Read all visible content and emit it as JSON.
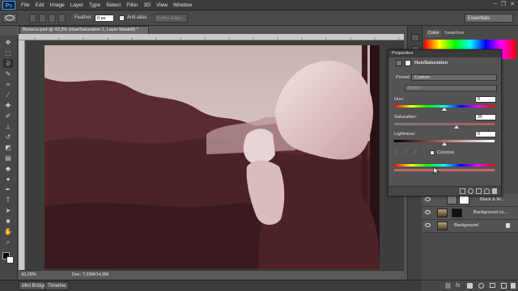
{
  "app": {
    "logo": "Ps"
  },
  "menu": [
    "File",
    "Edit",
    "Image",
    "Layer",
    "Type",
    "Select",
    "Filter",
    "3D",
    "View",
    "Window"
  ],
  "window_controls": {
    "minimize": "–",
    "restore": "❐",
    "close": "✕"
  },
  "options_bar": {
    "feather_label": "Feather:",
    "feather_value": "0 px",
    "antialias_label": "Anti-alias",
    "refine_edge_label": "Refine Edge...",
    "workspace": "Essentials"
  },
  "document": {
    "tab_title": "Волосы.psd @ 43,3% (Hue/Saturation 1, Layer Mask/8) *",
    "close_glyph": "×",
    "zoom": "43,28%",
    "doc_size": "Doc: 7,03M/14,9M"
  },
  "bottom_tabs": [
    "Mini Bridge",
    "Timeline"
  ],
  "panel_tabs": {
    "color": "Color",
    "swatches": "Swatches"
  },
  "properties": {
    "title": "Properties",
    "adjustment_name": "Hue/Saturation",
    "preset_label": "Preset:",
    "preset_value": "Custom",
    "channel_value": "Master",
    "hue_label": "Hue:",
    "hue_value": "0",
    "saturation_label": "Saturation:",
    "saturation_value": "25",
    "lightness_label": "Lightness:",
    "lightness_value": "0",
    "colorize_label": "Colorize"
  },
  "layers": [
    {
      "name": "Black & W...",
      "type": "adjustment"
    },
    {
      "name": "Background co...",
      "type": "masked"
    },
    {
      "name": "Background",
      "type": "background"
    }
  ],
  "colors": {
    "accent": "#39a3f5",
    "tint": "#7a4448"
  }
}
